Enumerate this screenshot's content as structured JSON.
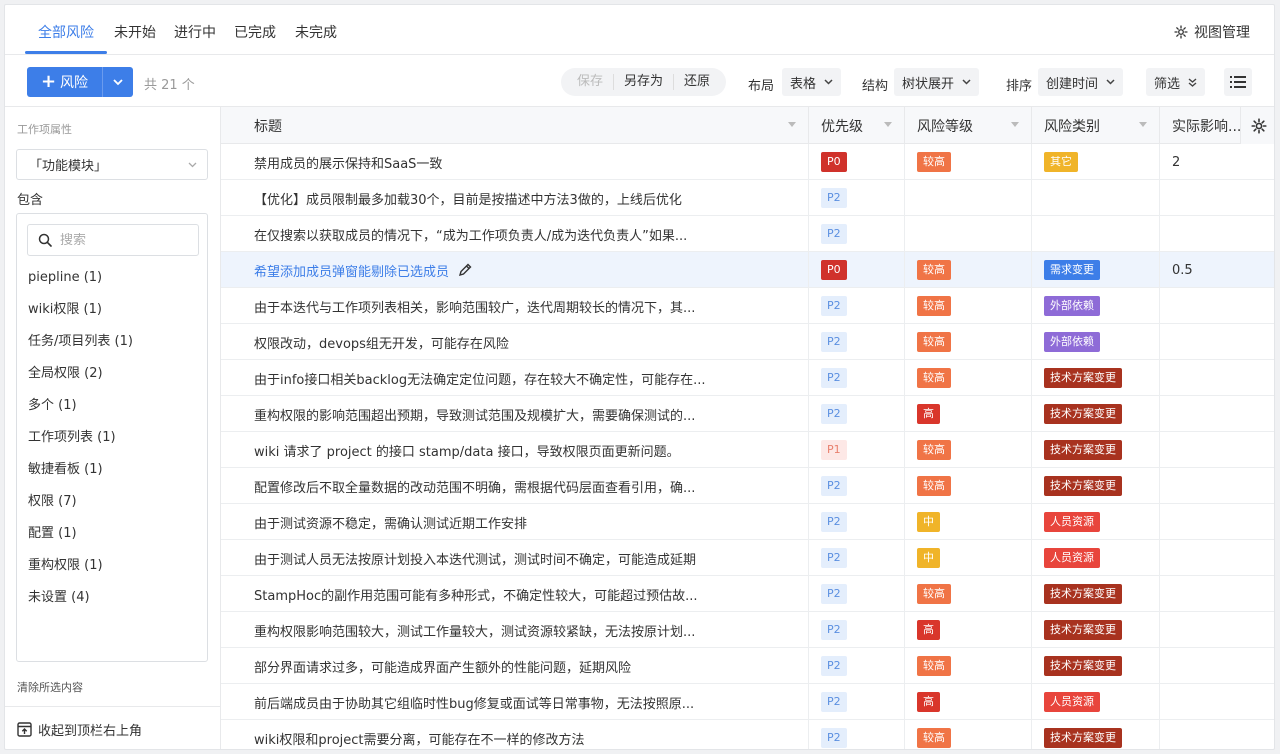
{
  "tabs": [
    {
      "label": "全部风险",
      "active": true
    },
    {
      "label": "未开始",
      "active": false
    },
    {
      "label": "进行中",
      "active": false
    },
    {
      "label": "已完成",
      "active": false
    },
    {
      "label": "未完成",
      "active": false
    }
  ],
  "view_manage": "视图管理",
  "toolbar": {
    "add_label": "风险",
    "count": "共 21 个",
    "save": "保存",
    "save_as": "另存为",
    "restore": "还原",
    "layout_label": "布局",
    "layout_value": "表格",
    "structure_label": "结构",
    "structure_value": "树状展开",
    "sort_label": "排序",
    "sort_value": "创建时间",
    "filter": "筛选"
  },
  "left_panel": {
    "title": "工作项属性",
    "select_value": "「功能模块」",
    "contains": "包含",
    "search_placeholder": "搜索",
    "items": [
      "piepline (1)",
      "wiki权限 (1)",
      "任务/项目列表 (1)",
      "全局权限 (2)",
      "多个 (1)",
      "工作项列表 (1)",
      "敏捷看板 (1)",
      "权限 (7)",
      "配置 (1)",
      "重构权限 (1)",
      "未设置 (4)"
    ],
    "clear": "清除所选内容",
    "collapse": "收起到顶栏右上角"
  },
  "columns": {
    "title": "标题",
    "priority": "优先级",
    "level": "风险等级",
    "category": "风险类别",
    "impact": "实际影响..."
  },
  "colors": {
    "accent": "#3d7ee8",
    "P0": "#d0322b",
    "P1_bg": "#fde8e6",
    "P2_bg": "#e4eefc",
    "level_high": "#f07446",
    "level_very_high": "#d9362b",
    "level_mid": "#f0b429",
    "cat_other": "#f0b429",
    "cat_req": "#3d7ee8",
    "cat_ext": "#8e6bd7",
    "cat_tech": "#a8321f",
    "cat_hr": "#e8453c"
  },
  "rows": [
    {
      "title": "禁用成员的展示保持和SaaS一致",
      "priority": "P0",
      "level": "较高",
      "category": "其它",
      "impact": "2"
    },
    {
      "title": "【优化】成员限制最多加载30个，目前是按描述中方法3做的，上线后优化",
      "priority": "P2",
      "level": "",
      "category": "",
      "impact": ""
    },
    {
      "title": "在仅搜索以获取成员的情况下，“成为工作项负责人/成为迭代负责人”如果...",
      "priority": "P2",
      "level": "",
      "category": "",
      "impact": ""
    },
    {
      "title": "希望添加成员弹窗能剔除已选成员",
      "priority": "P0",
      "level": "较高",
      "category": "需求变更",
      "impact": "0.5",
      "highlight": true
    },
    {
      "title": "由于本迭代与工作项列表相关，影响范围较广，迭代周期较长的情况下，其...",
      "priority": "P2",
      "level": "较高",
      "category": "外部依赖",
      "impact": ""
    },
    {
      "title": "权限改动，devops组无开发，可能存在风险",
      "priority": "P2",
      "level": "较高",
      "category": "外部依赖",
      "impact": ""
    },
    {
      "title": "由于info接口相关backlog无法确定定位问题，存在较大不确定性，可能存在...",
      "priority": "P2",
      "level": "较高",
      "category": "技术方案变更",
      "impact": ""
    },
    {
      "title": "重构权限的影响范围超出预期，导致测试范围及规模扩大，需要确保测试的...",
      "priority": "P2",
      "level": "高",
      "category": "技术方案变更",
      "impact": ""
    },
    {
      "title": "wiki 请求了 project 的接口 stamp/data 接口，导致权限页面更新问题。",
      "priority": "P1",
      "level": "较高",
      "category": "技术方案变更",
      "impact": ""
    },
    {
      "title": "配置修改后不取全量数据的改动范围不明确，需根据代码层面查看引用，确...",
      "priority": "P2",
      "level": "较高",
      "category": "技术方案变更",
      "impact": ""
    },
    {
      "title": "由于测试资源不稳定，需确认测试近期工作安排",
      "priority": "P2",
      "level": "中",
      "category": "人员资源",
      "impact": ""
    },
    {
      "title": "由于测试人员无法按原计划投入本迭代测试，测试时间不确定，可能造成延期",
      "priority": "P2",
      "level": "中",
      "category": "人员资源",
      "impact": ""
    },
    {
      "title": "StampHoc的副作用范围可能有多种形式，不确定性较大，可能超过预估故...",
      "priority": "P2",
      "level": "较高",
      "category": "技术方案变更",
      "impact": ""
    },
    {
      "title": "重构权限影响范围较大，测试工作量较大，测试资源较紧缺，无法按原计划...",
      "priority": "P2",
      "level": "高",
      "category": "技术方案变更",
      "impact": ""
    },
    {
      "title": "部分界面请求过多，可能造成界面产生额外的性能问题，延期风险",
      "priority": "P2",
      "level": "较高",
      "category": "技术方案变更",
      "impact": ""
    },
    {
      "title": "前后端成员由于协助其它组临时性bug修复或面试等日常事物，无法按照原...",
      "priority": "P2",
      "level": "高",
      "category": "人员资源",
      "impact": ""
    },
    {
      "title": "wiki权限和project需要分离，可能存在不一样的修改方法",
      "priority": "P2",
      "level": "较高",
      "category": "技术方案变更",
      "impact": ""
    }
  ]
}
